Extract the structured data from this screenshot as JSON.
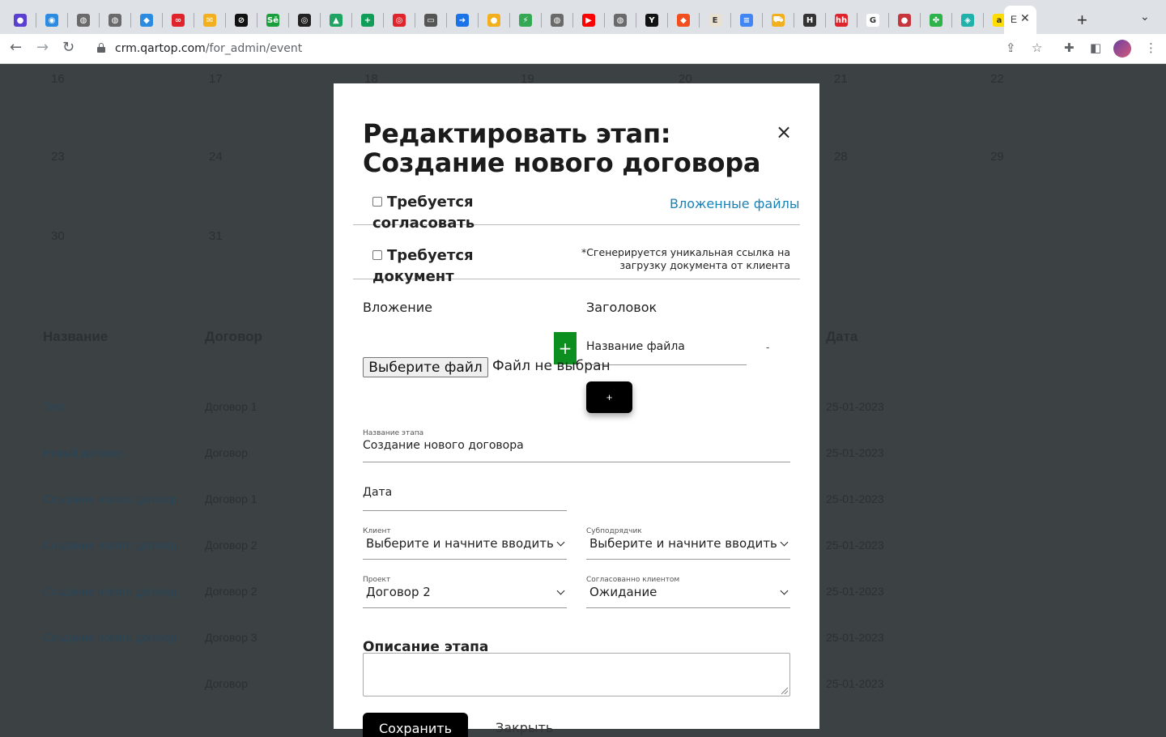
{
  "browser": {
    "url_host": "crm.qartop.com",
    "url_path": "/for_admin/event",
    "active_tab_label": "E",
    "tab_favicons": [
      {
        "name": "favicon-globe-purple",
        "color": "#5b3fd1",
        "glyph": "●"
      },
      {
        "name": "favicon-blue-circle",
        "color": "#2a8be0",
        "glyph": "◉"
      },
      {
        "name": "favicon-globe-gray",
        "color": "#6a6a6a",
        "glyph": "◍"
      },
      {
        "name": "favicon-globe-gray",
        "color": "#6a6a6a",
        "glyph": "◍"
      },
      {
        "name": "favicon-drop",
        "color": "#2a8be0",
        "glyph": "◆"
      },
      {
        "name": "favicon-red-infinity",
        "color": "#e0242b",
        "glyph": "∞"
      },
      {
        "name": "favicon-mail",
        "color": "#f2b01e",
        "glyph": "✉"
      },
      {
        "name": "favicon-link-black",
        "color": "#111111",
        "glyph": "⊘"
      },
      {
        "name": "favicon-green-se",
        "color": "#1a9f3c",
        "glyph": "Sē"
      },
      {
        "name": "favicon-github",
        "color": "#222222",
        "glyph": "◎"
      },
      {
        "name": "favicon-drive",
        "color": "#1fa463",
        "glyph": "▲"
      },
      {
        "name": "favicon-green-plus",
        "color": "#0f9d58",
        "glyph": "+"
      },
      {
        "name": "favicon-target",
        "color": "#e0242b",
        "glyph": "◎"
      },
      {
        "name": "favicon-book",
        "color": "#555555",
        "glyph": "▭"
      },
      {
        "name": "favicon-arrow-blue",
        "color": "#1a73e8",
        "glyph": "➜"
      },
      {
        "name": "favicon-yellow-blob",
        "color": "#f2b01e",
        "glyph": "●"
      },
      {
        "name": "favicon-colorful",
        "color": "#34a853",
        "glyph": "⚡"
      },
      {
        "name": "favicon-globe-gray",
        "color": "#6a6a6a",
        "glyph": "◍"
      },
      {
        "name": "favicon-youtube",
        "color": "#ff0000",
        "glyph": "▶"
      },
      {
        "name": "favicon-globe-gray",
        "color": "#6a6a6a",
        "glyph": "◍"
      },
      {
        "name": "favicon-y-black",
        "color": "#111111",
        "glyph": "Y"
      },
      {
        "name": "favicon-figma",
        "color": "#f24e1e",
        "glyph": "◆"
      },
      {
        "name": "favicon-e",
        "color": "#e8e0d0",
        "glyph": "E"
      },
      {
        "name": "favicon-docs",
        "color": "#4285f4",
        "glyph": "≡"
      },
      {
        "name": "favicon-cart",
        "color": "#f2b01e",
        "glyph": "⛟"
      },
      {
        "name": "favicon-hd",
        "color": "#333333",
        "glyph": "H"
      },
      {
        "name": "favicon-hh",
        "color": "#e0242b",
        "glyph": "hh"
      },
      {
        "name": "favicon-google",
        "color": "#ffffff",
        "glyph": "G"
      },
      {
        "name": "favicon-flag",
        "color": "#c6363c",
        "glyph": "●"
      },
      {
        "name": "favicon-clover",
        "color": "#2db34a",
        "glyph": "✤"
      },
      {
        "name": "favicon-teal",
        "color": "#20b2aa",
        "glyph": "◈"
      },
      {
        "name": "favicon-yellow",
        "color": "#ffdd00",
        "glyph": "a"
      }
    ],
    "new_tab": "+",
    "tab_menu": "⌄"
  },
  "background": {
    "calendar_numbers": [
      {
        "label": "16"
      },
      {
        "label": "17"
      },
      {
        "label": "18"
      },
      {
        "label": "19"
      },
      {
        "label": "20"
      },
      {
        "label": "21"
      },
      {
        "label": "22"
      },
      {
        "label": "23"
      },
      {
        "label": "24"
      },
      {
        "label": "28"
      },
      {
        "label": "29"
      },
      {
        "label": "30"
      },
      {
        "label": "31"
      }
    ],
    "table_headers": {
      "name": "Название",
      "contract": "Договор",
      "date": "Дата"
    },
    "rows": [
      {
        "name": "Test",
        "contract": "Договор 1",
        "date": "25-01-2023"
      },
      {
        "name": "Новый договор",
        "contract": "Договор",
        "date": "25-01-2023"
      },
      {
        "name": "Создание нового договор",
        "contract": "Договор 1",
        "date": "25-01-2023"
      },
      {
        "name": "Создание нового договор",
        "contract": "Договор 2",
        "date": "25-01-2023"
      },
      {
        "name": "Создание нового договор",
        "contract": "Договор 2",
        "date": "25-01-2023"
      },
      {
        "name": "Создание нового договор",
        "contract": "Договор 3",
        "date": "25-01-2023"
      },
      {
        "name": "",
        "contract": "Договор",
        "date": "25-01-2023"
      }
    ]
  },
  "modal": {
    "title": "Редактировать этап: Создание нового договора",
    "close_icon": "×",
    "requires_approval_label": "Требуется согласовать",
    "attached_files_link": "Вложенные файлы",
    "requires_document_label": "Требуется документ",
    "document_note": "*Сгенерируется уникальная ссылка на загрузку документа от клиента",
    "attachment_header": "Вложение",
    "title_header": "Заголовок",
    "file_button": "Выберите файл",
    "file_status": "Файл не выбран",
    "file_title_value": "Название файла",
    "add_file_plus": "+",
    "remove_file": "-",
    "add_row_button": "+",
    "stage_name_label": "Название этапа",
    "stage_name_value": "Создание нового договора",
    "date_placeholder": "Дата",
    "client_label": "Клиент",
    "client_value": "Выберите и начните вводить",
    "subcontractor_label": "Субподрядчик",
    "subcontractor_value": "Выберите и начните вводить",
    "project_label": "Проект",
    "project_value": "Договор 2",
    "approved_label": "Согласованно клиентом",
    "approved_value": "Ожидание",
    "description_header": "Описание этапа",
    "save_button": "Сохранить",
    "close_link": "Закрыть"
  }
}
